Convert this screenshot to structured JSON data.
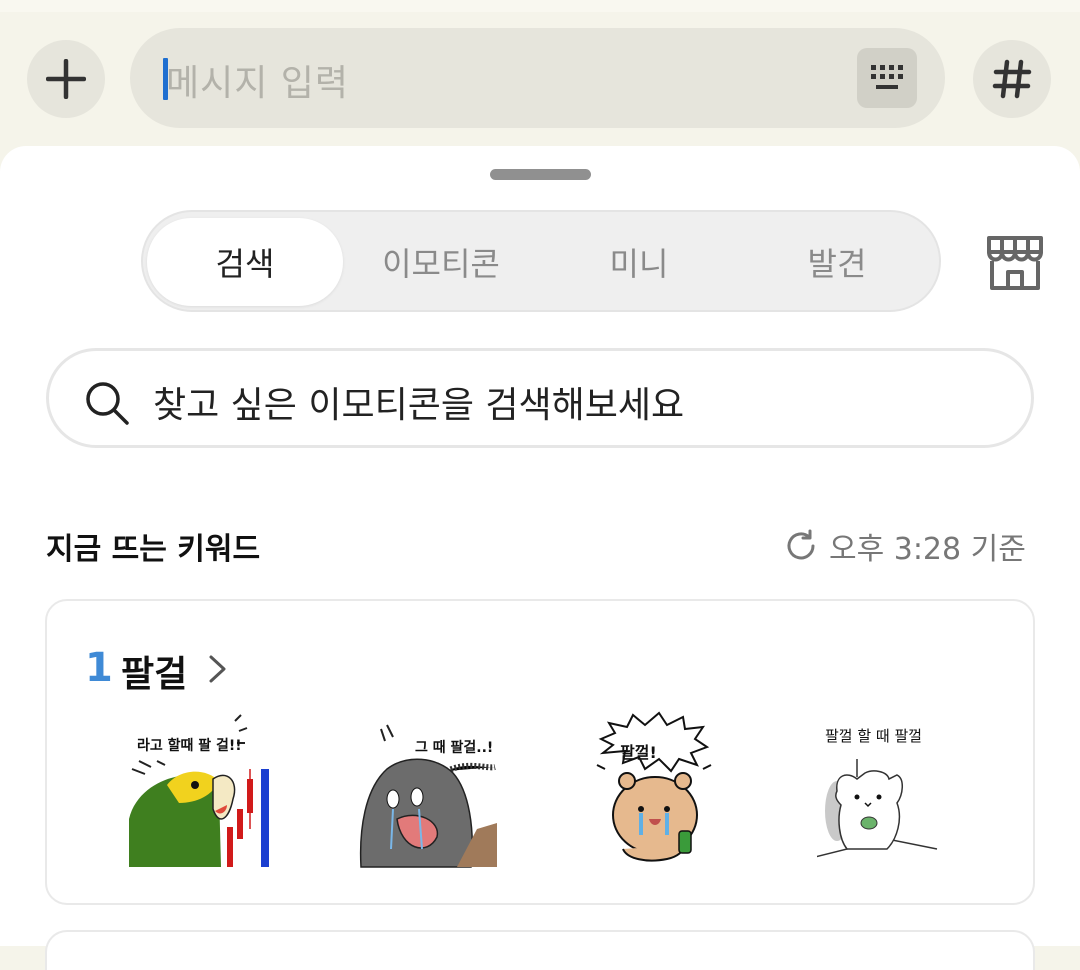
{
  "input_bar": {
    "placeholder": "메시지 입력",
    "plus_icon": "plus-icon",
    "keyboard_icon": "keyboard-icon",
    "hash_icon": "hashtag-icon"
  },
  "panel": {
    "tabs": [
      {
        "label": "검색",
        "active": true
      },
      {
        "label": "이모티콘",
        "active": false
      },
      {
        "label": "미니",
        "active": false
      },
      {
        "label": "발견",
        "active": false
      }
    ],
    "store_icon": "store-icon",
    "search": {
      "placeholder": "찾고 싶은 이모티콘을 검색해보세요",
      "icon": "search-icon"
    },
    "trending": {
      "title": "지금 뜨는 키워드",
      "time": "오후 3:28 기준",
      "refresh_icon": "refresh-icon"
    },
    "keyword_card": {
      "rank": "1",
      "keyword": "팔걸",
      "emoticons": [
        {
          "caption": "라고 할때 팔 걸!!",
          "subject": "parrot"
        },
        {
          "caption": "그 때 팔걸..!",
          "subject": "elephant"
        },
        {
          "caption": "팔껄!",
          "subject": "crying-bear"
        },
        {
          "caption": "팔껄 할 때 팔껄",
          "subject": "white-cat"
        }
      ]
    }
  },
  "colors": {
    "accent_blue": "#3f8ad6",
    "caret_blue": "#1f6fd0",
    "top_background": "#f5f4ea"
  }
}
